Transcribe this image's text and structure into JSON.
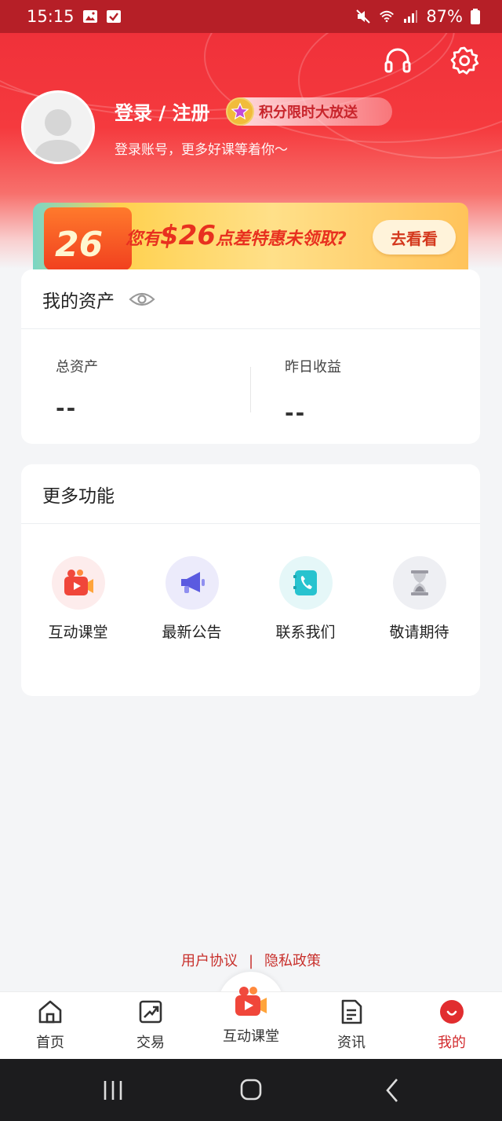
{
  "status_bar": {
    "time": "15:15",
    "battery": "87%"
  },
  "profile": {
    "login_title": "登录 / 注册",
    "points_badge": "积分限时大放送",
    "subtitle": "登录账号，更多好课等着你～"
  },
  "banner": {
    "gift_number": "26",
    "text_prefix": "您有",
    "text_amount": "$26",
    "text_suffix": "点差特惠未领取?",
    "button": "去看看"
  },
  "assets": {
    "title": "我的资产",
    "total_label": "总资产",
    "total_value": "--",
    "yesterday_label": "昨日收益",
    "yesterday_value": "--"
  },
  "more": {
    "title": "更多功能",
    "items": [
      {
        "label": "互动课堂",
        "icon": "video-class-icon"
      },
      {
        "label": "最新公告",
        "icon": "megaphone-icon"
      },
      {
        "label": "联系我们",
        "icon": "phone-book-icon"
      },
      {
        "label": "敬请期待",
        "icon": "hourglass-icon"
      }
    ]
  },
  "footer_links": {
    "user_agreement": "用户协议",
    "separator": "|",
    "privacy": "隐私政策"
  },
  "tabs": [
    {
      "label": "首页",
      "icon": "home-icon"
    },
    {
      "label": "交易",
      "icon": "trade-icon"
    },
    {
      "label": "互动课堂",
      "icon": "video-class-icon"
    },
    {
      "label": "资讯",
      "icon": "news-icon"
    },
    {
      "label": "我的",
      "icon": "me-icon",
      "active": true
    }
  ],
  "colors": {
    "brand_red": "#e8333a",
    "tab_active": "#d22a2d",
    "link_red": "#c8302c"
  }
}
